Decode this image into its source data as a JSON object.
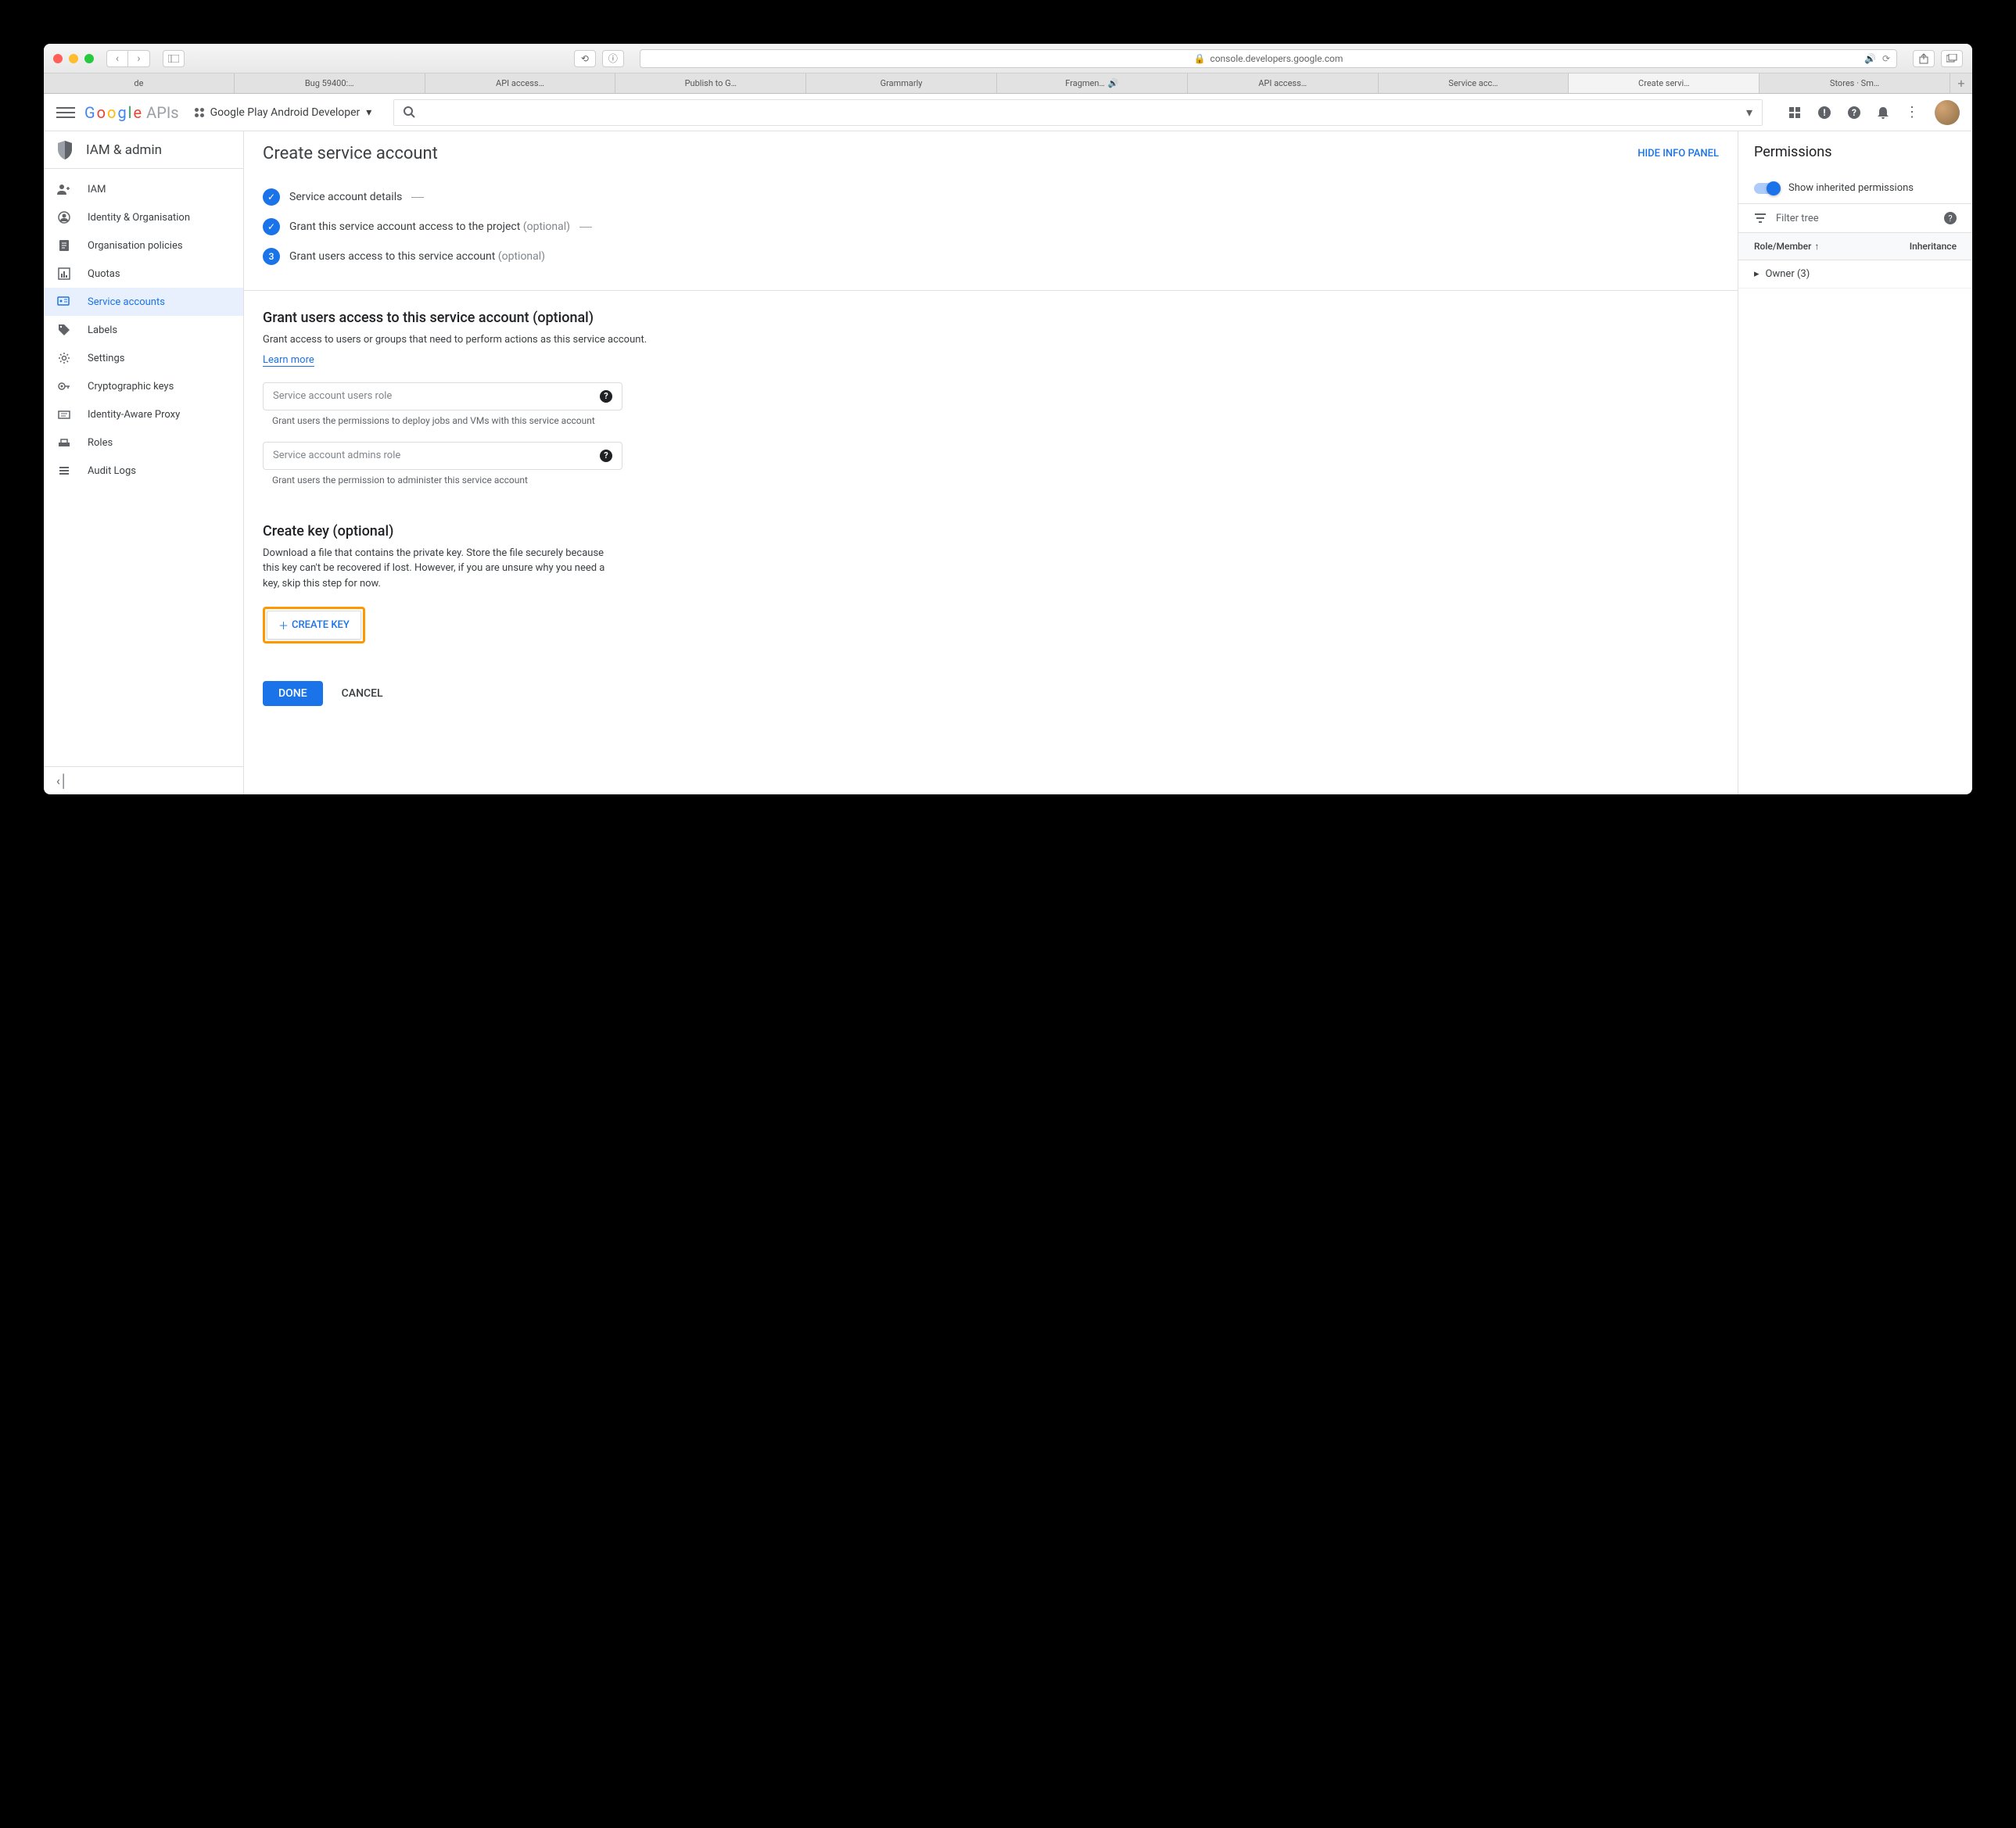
{
  "browser": {
    "url": "console.developers.google.com",
    "tabs": [
      "de",
      "Bug 59400:…",
      "API access…",
      "Publish to G…",
      "Grammarly",
      "Fragmen…",
      "API access…",
      "Service acc…",
      "Create servi…",
      "Stores · Sm…"
    ],
    "active_tab_index": 8
  },
  "gheader": {
    "project": "Google Play Android Developer"
  },
  "section": {
    "title": "IAM & admin",
    "nav": [
      {
        "label": "IAM"
      },
      {
        "label": "Identity & Organisation"
      },
      {
        "label": "Organisation policies"
      },
      {
        "label": "Quotas"
      },
      {
        "label": "Service accounts"
      },
      {
        "label": "Labels"
      },
      {
        "label": "Settings"
      },
      {
        "label": "Cryptographic keys"
      },
      {
        "label": "Identity-Aware Proxy"
      },
      {
        "label": "Roles"
      },
      {
        "label": "Audit Logs"
      }
    ],
    "active_nav_index": 4
  },
  "page": {
    "title": "Create service account",
    "hide_panel": "HIDE INFO PANEL",
    "steps": [
      {
        "label": "Service account details",
        "done": true
      },
      {
        "label": "Grant this service account access to the project",
        "optional": "(optional)",
        "done": true
      },
      {
        "label": "Grant users access to this service account",
        "optional": "(optional)",
        "num": "3"
      }
    ],
    "grant_section": {
      "heading": "Grant users access to this service account (optional)",
      "desc": "Grant access to users or groups that need to perform actions as this service account.",
      "learn_more": "Learn more",
      "field1": {
        "placeholder": "Service account users role",
        "hint": "Grant users the permissions to deploy jobs and VMs with this service account"
      },
      "field2": {
        "placeholder": "Service account admins role",
        "hint": "Grant users the permission to administer this service account"
      }
    },
    "key_section": {
      "heading": "Create key (optional)",
      "desc": "Download a file that contains the private key. Store the file securely because this key can't be recovered if lost. However, if you are unsure why you need a key, skip this step for now.",
      "button": "CREATE KEY"
    },
    "actions": {
      "done": "DONE",
      "cancel": "CANCEL"
    }
  },
  "right_panel": {
    "title": "Permissions",
    "toggle_label": "Show inherited permissions",
    "filter_placeholder": "Filter tree",
    "col_role": "Role/Member",
    "col_inherit": "Inheritance",
    "row1": "Owner (3)"
  }
}
